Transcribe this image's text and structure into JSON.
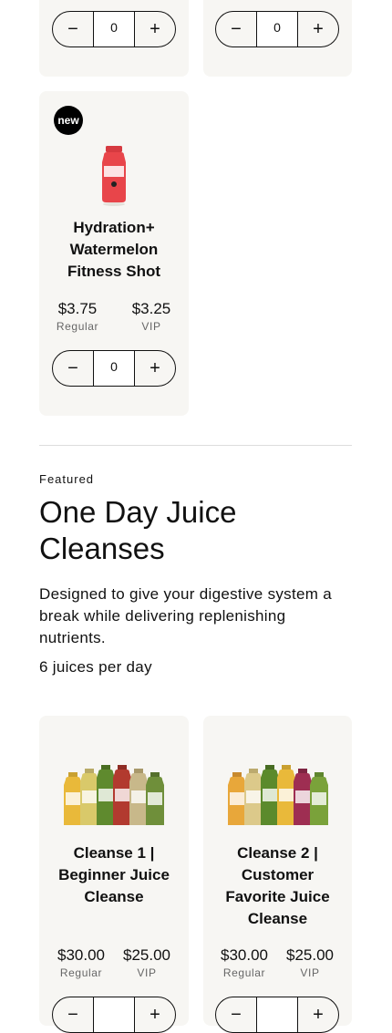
{
  "top_cards": [
    {
      "qty": "0"
    },
    {
      "qty": "0"
    }
  ],
  "hydration": {
    "badge": "new",
    "name_lines": [
      "Hydration+",
      "Watermelon",
      "Fitness Shot"
    ],
    "regular_price": "$3.75",
    "regular_label": "Regular",
    "vip_price": "$3.25",
    "vip_label": "VIP",
    "qty": "0",
    "bottle_color": "#e8454a"
  },
  "featured": {
    "eyebrow": "Featured",
    "title": "One Day Juice Cleanses",
    "description": "Designed to give your digestive system a break while delivering replenishing nutrients.",
    "per_day": "6 juices per day"
  },
  "cleanses": [
    {
      "name_lines": [
        "Cleanse 1 |",
        "Beginner Juice",
        "Cleanse"
      ],
      "regular_price": "$30.00",
      "regular_label": "Regular",
      "vip_price": "$25.00",
      "vip_label": "VIP",
      "bottle_colors": [
        "#e9b93a",
        "#d9c96a",
        "#5f8a2e",
        "#b23a2f",
        "#c8b88a",
        "#6f8f3a"
      ]
    },
    {
      "name_lines": [
        "Cleanse 2 |",
        "Customer",
        "Favorite Juice",
        "Cleanse"
      ],
      "regular_price": "$30.00",
      "regular_label": "Regular",
      "vip_price": "$25.00",
      "vip_label": "VIP",
      "bottle_colors": [
        "#e8a73a",
        "#dcc98a",
        "#5b8a2c",
        "#e9b93a",
        "#9e2e52",
        "#7aa23a"
      ]
    }
  ],
  "icons": {
    "minus": "minus-icon",
    "plus": "plus-icon"
  }
}
